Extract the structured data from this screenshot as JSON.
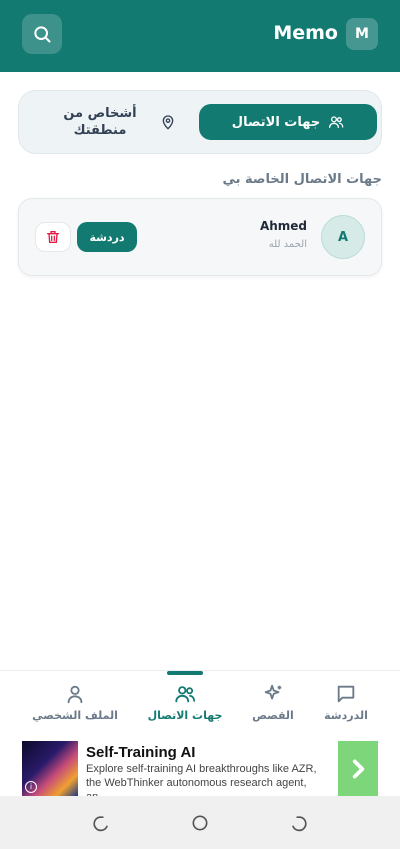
{
  "app": {
    "title": "Memo",
    "avatar_letter": "M"
  },
  "tabs": {
    "contacts": "جهات الاتصال",
    "nearby": "أشخاص من منطقتك"
  },
  "section_title": "جهات الاتصال الخاصة بي",
  "contacts": [
    {
      "name": "Ahmed",
      "status": "الحمد لله",
      "avatar": "A",
      "chat_label": "دردشة"
    }
  ],
  "bottom_nav": [
    {
      "label": "الدردشة",
      "icon": "chat-icon"
    },
    {
      "label": "القصص",
      "icon": "sparkles-icon"
    },
    {
      "label": "جهات الاتصال",
      "icon": "users-icon",
      "active": true
    },
    {
      "label": "الملف الشخصي",
      "icon": "user-icon"
    }
  ],
  "ad": {
    "title": "Self-Training AI",
    "description": "Explore self-training AI breakthroughs like AZR, the WebThinker autonomous research agent, an..."
  },
  "colors": {
    "primary": "#137a72",
    "danger": "#e11d48"
  }
}
